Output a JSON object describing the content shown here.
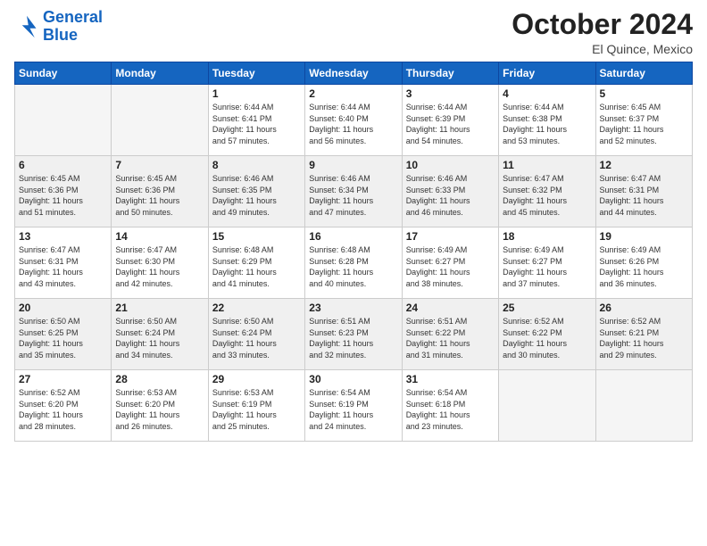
{
  "header": {
    "logo_line1": "General",
    "logo_line2": "Blue",
    "month": "October 2024",
    "location": "El Quince, Mexico"
  },
  "weekdays": [
    "Sunday",
    "Monday",
    "Tuesday",
    "Wednesday",
    "Thursday",
    "Friday",
    "Saturday"
  ],
  "weeks": [
    [
      {
        "day": "",
        "detail": ""
      },
      {
        "day": "",
        "detail": ""
      },
      {
        "day": "1",
        "detail": "Sunrise: 6:44 AM\nSunset: 6:41 PM\nDaylight: 11 hours\nand 57 minutes."
      },
      {
        "day": "2",
        "detail": "Sunrise: 6:44 AM\nSunset: 6:40 PM\nDaylight: 11 hours\nand 56 minutes."
      },
      {
        "day": "3",
        "detail": "Sunrise: 6:44 AM\nSunset: 6:39 PM\nDaylight: 11 hours\nand 54 minutes."
      },
      {
        "day": "4",
        "detail": "Sunrise: 6:44 AM\nSunset: 6:38 PM\nDaylight: 11 hours\nand 53 minutes."
      },
      {
        "day": "5",
        "detail": "Sunrise: 6:45 AM\nSunset: 6:37 PM\nDaylight: 11 hours\nand 52 minutes."
      }
    ],
    [
      {
        "day": "6",
        "detail": "Sunrise: 6:45 AM\nSunset: 6:36 PM\nDaylight: 11 hours\nand 51 minutes."
      },
      {
        "day": "7",
        "detail": "Sunrise: 6:45 AM\nSunset: 6:36 PM\nDaylight: 11 hours\nand 50 minutes."
      },
      {
        "day": "8",
        "detail": "Sunrise: 6:46 AM\nSunset: 6:35 PM\nDaylight: 11 hours\nand 49 minutes."
      },
      {
        "day": "9",
        "detail": "Sunrise: 6:46 AM\nSunset: 6:34 PM\nDaylight: 11 hours\nand 47 minutes."
      },
      {
        "day": "10",
        "detail": "Sunrise: 6:46 AM\nSunset: 6:33 PM\nDaylight: 11 hours\nand 46 minutes."
      },
      {
        "day": "11",
        "detail": "Sunrise: 6:47 AM\nSunset: 6:32 PM\nDaylight: 11 hours\nand 45 minutes."
      },
      {
        "day": "12",
        "detail": "Sunrise: 6:47 AM\nSunset: 6:31 PM\nDaylight: 11 hours\nand 44 minutes."
      }
    ],
    [
      {
        "day": "13",
        "detail": "Sunrise: 6:47 AM\nSunset: 6:31 PM\nDaylight: 11 hours\nand 43 minutes."
      },
      {
        "day": "14",
        "detail": "Sunrise: 6:47 AM\nSunset: 6:30 PM\nDaylight: 11 hours\nand 42 minutes."
      },
      {
        "day": "15",
        "detail": "Sunrise: 6:48 AM\nSunset: 6:29 PM\nDaylight: 11 hours\nand 41 minutes."
      },
      {
        "day": "16",
        "detail": "Sunrise: 6:48 AM\nSunset: 6:28 PM\nDaylight: 11 hours\nand 40 minutes."
      },
      {
        "day": "17",
        "detail": "Sunrise: 6:49 AM\nSunset: 6:27 PM\nDaylight: 11 hours\nand 38 minutes."
      },
      {
        "day": "18",
        "detail": "Sunrise: 6:49 AM\nSunset: 6:27 PM\nDaylight: 11 hours\nand 37 minutes."
      },
      {
        "day": "19",
        "detail": "Sunrise: 6:49 AM\nSunset: 6:26 PM\nDaylight: 11 hours\nand 36 minutes."
      }
    ],
    [
      {
        "day": "20",
        "detail": "Sunrise: 6:50 AM\nSunset: 6:25 PM\nDaylight: 11 hours\nand 35 minutes."
      },
      {
        "day": "21",
        "detail": "Sunrise: 6:50 AM\nSunset: 6:24 PM\nDaylight: 11 hours\nand 34 minutes."
      },
      {
        "day": "22",
        "detail": "Sunrise: 6:50 AM\nSunset: 6:24 PM\nDaylight: 11 hours\nand 33 minutes."
      },
      {
        "day": "23",
        "detail": "Sunrise: 6:51 AM\nSunset: 6:23 PM\nDaylight: 11 hours\nand 32 minutes."
      },
      {
        "day": "24",
        "detail": "Sunrise: 6:51 AM\nSunset: 6:22 PM\nDaylight: 11 hours\nand 31 minutes."
      },
      {
        "day": "25",
        "detail": "Sunrise: 6:52 AM\nSunset: 6:22 PM\nDaylight: 11 hours\nand 30 minutes."
      },
      {
        "day": "26",
        "detail": "Sunrise: 6:52 AM\nSunset: 6:21 PM\nDaylight: 11 hours\nand 29 minutes."
      }
    ],
    [
      {
        "day": "27",
        "detail": "Sunrise: 6:52 AM\nSunset: 6:20 PM\nDaylight: 11 hours\nand 28 minutes."
      },
      {
        "day": "28",
        "detail": "Sunrise: 6:53 AM\nSunset: 6:20 PM\nDaylight: 11 hours\nand 26 minutes."
      },
      {
        "day": "29",
        "detail": "Sunrise: 6:53 AM\nSunset: 6:19 PM\nDaylight: 11 hours\nand 25 minutes."
      },
      {
        "day": "30",
        "detail": "Sunrise: 6:54 AM\nSunset: 6:19 PM\nDaylight: 11 hours\nand 24 minutes."
      },
      {
        "day": "31",
        "detail": "Sunrise: 6:54 AM\nSunset: 6:18 PM\nDaylight: 11 hours\nand 23 minutes."
      },
      {
        "day": "",
        "detail": ""
      },
      {
        "day": "",
        "detail": ""
      }
    ]
  ]
}
